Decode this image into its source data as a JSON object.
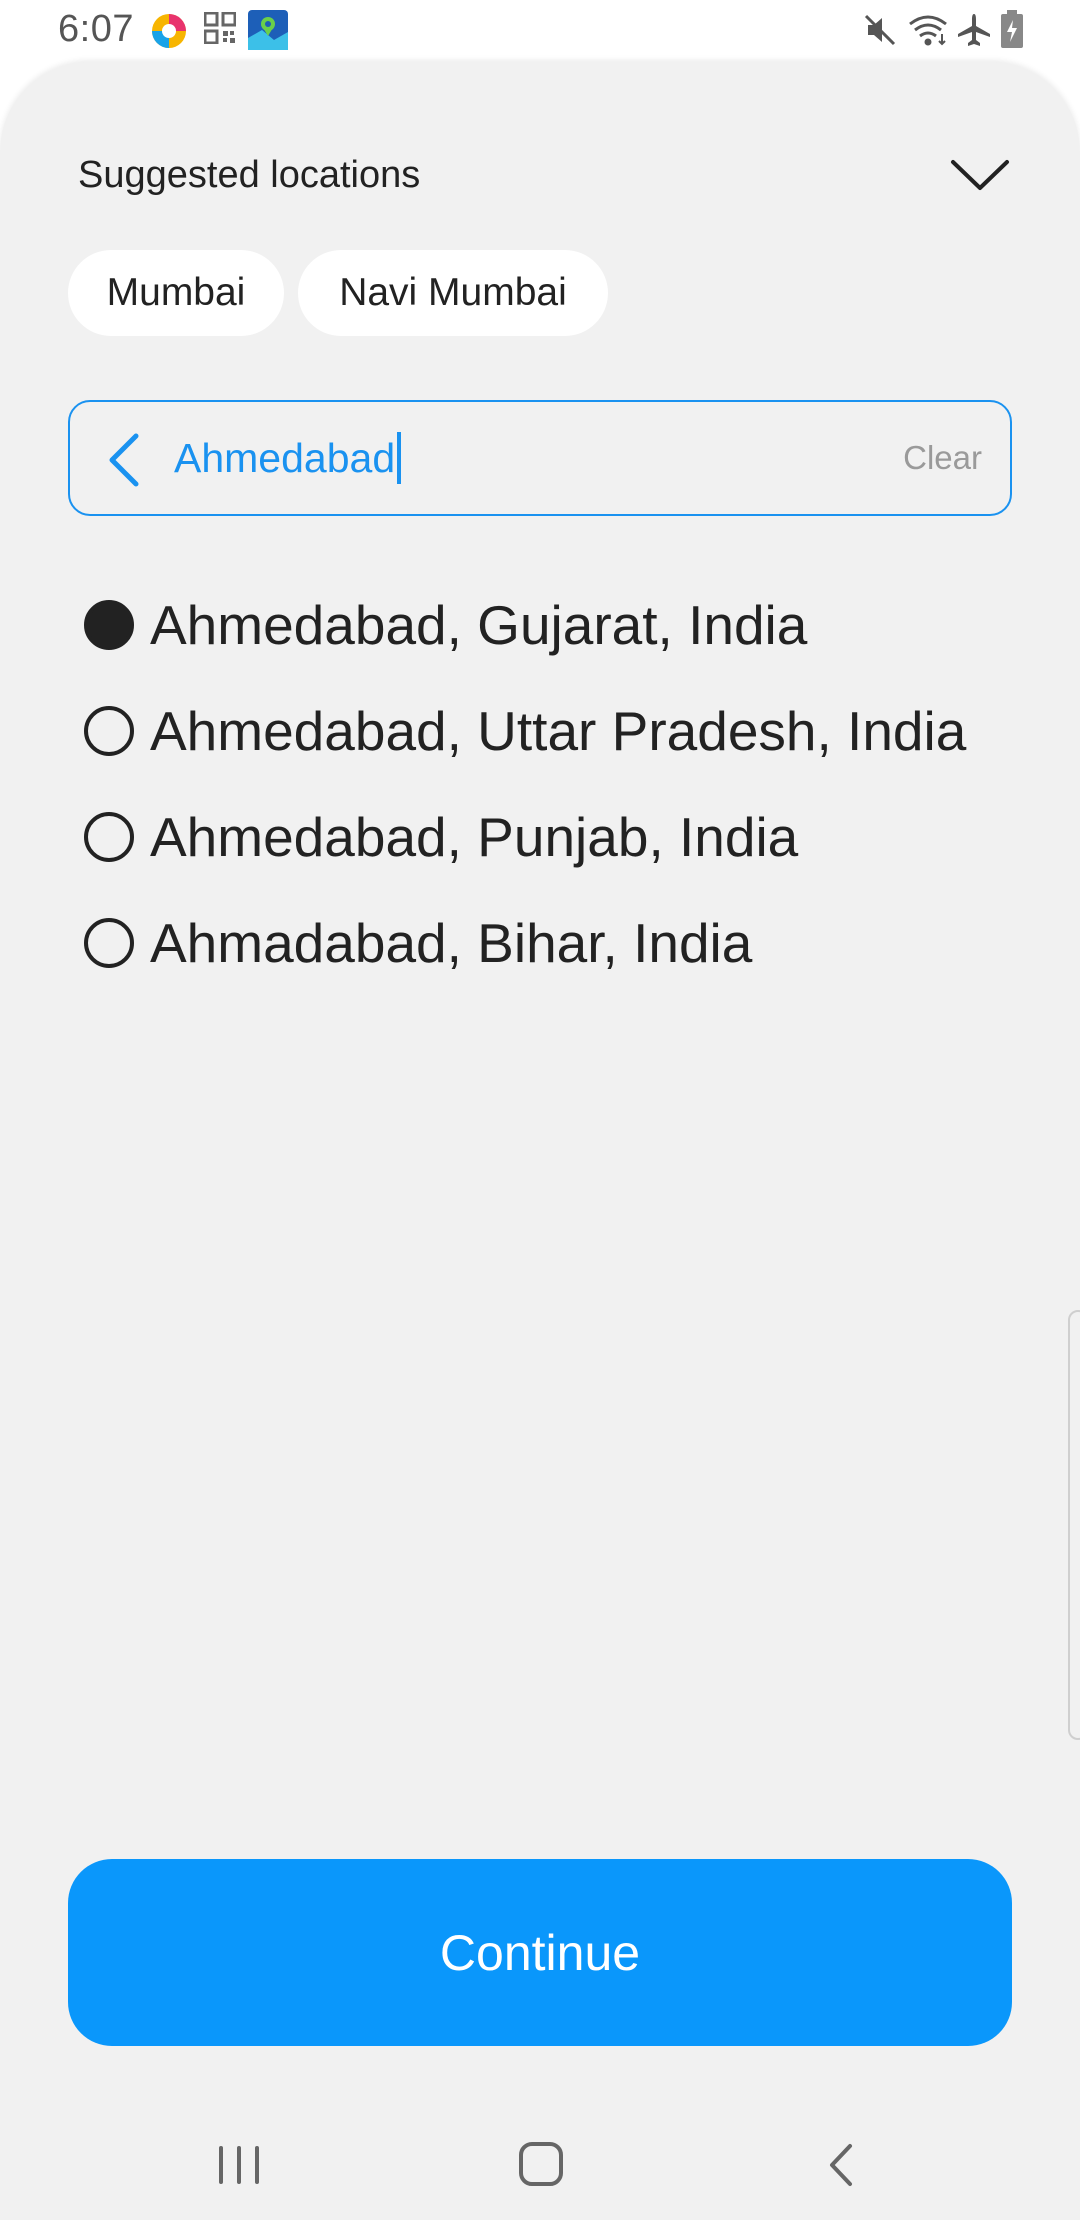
{
  "status_bar": {
    "time": "6:07",
    "left_icons": [
      "app-round-icon",
      "qr-code-icon",
      "maps-app-icon"
    ],
    "right_icons": [
      "mute-icon",
      "wifi-icon",
      "airplane-icon",
      "battery-icon"
    ]
  },
  "sheet": {
    "title": "Suggested locations",
    "collapse_icon": "chevron-down-icon",
    "chips": [
      "Mumbai",
      "Navi Mumbai"
    ],
    "search": {
      "value": "Ahmedabad",
      "clear_label": "Clear",
      "back_icon": "chevron-left-icon"
    },
    "options": [
      {
        "label": "Ahmedabad, Gujarat, India",
        "selected": true
      },
      {
        "label": "Ahmedabad, Uttar Pradesh, India",
        "selected": false
      },
      {
        "label": "Ahmedabad, Punjab, India",
        "selected": false
      },
      {
        "label": "Ahmadabad, Bihar, India",
        "selected": false
      }
    ],
    "continue_label": "Continue"
  },
  "nav_bar": {
    "icons": [
      "recents-icon",
      "home-icon",
      "back-icon"
    ]
  },
  "colors": {
    "accent": "#0a97fb",
    "search_text": "#1a92f0",
    "sheet_bg": "#f1f1f1"
  }
}
